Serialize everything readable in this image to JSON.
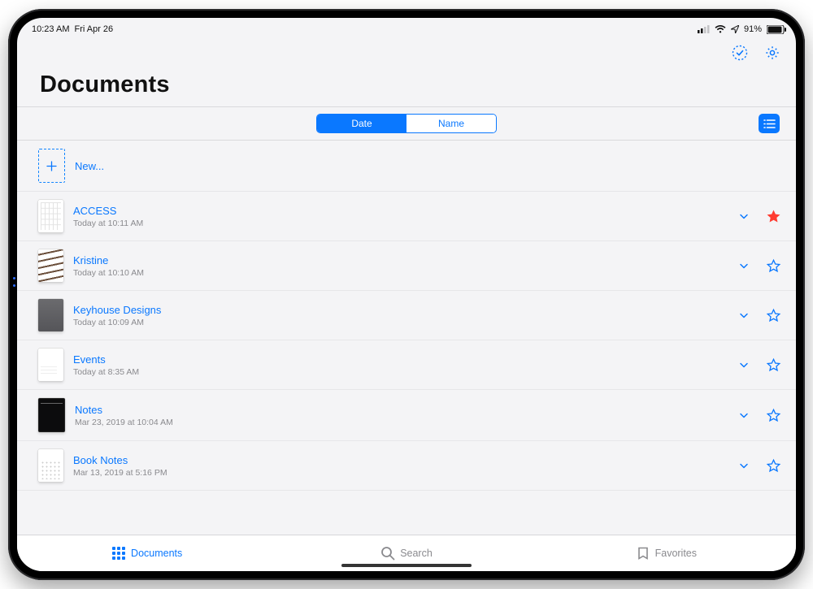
{
  "status": {
    "time": "10:23 AM",
    "date": "Fri Apr 26",
    "battery": "91%"
  },
  "header": {
    "title": "Documents"
  },
  "sort": {
    "option_a": "Date",
    "option_b": "Name",
    "active": "Date"
  },
  "newRow": {
    "label": "New..."
  },
  "docs": [
    {
      "title": "ACCESS",
      "sub": "Today at 10:11 AM",
      "thumb": "grid",
      "starred": true
    },
    {
      "title": "Kristine",
      "sub": "Today at 10:10 AM",
      "thumb": "waves",
      "starred": false
    },
    {
      "title": "Keyhouse Designs",
      "sub": "Today at 10:09 AM",
      "thumb": "dark",
      "starred": false
    },
    {
      "title": "Events",
      "sub": "Today at 8:35 AM",
      "thumb": "plain",
      "starred": false
    },
    {
      "title": "Notes",
      "sub": "Mar 23, 2019 at 10:04 AM",
      "thumb": "black",
      "starred": false
    },
    {
      "title": "Book Notes",
      "sub": "Mar 13, 2019 at 5:16 PM",
      "thumb": "dots",
      "starred": false
    }
  ],
  "tabs": {
    "documents": "Documents",
    "search": "Search",
    "favorites": "Favorites",
    "active": "documents"
  }
}
